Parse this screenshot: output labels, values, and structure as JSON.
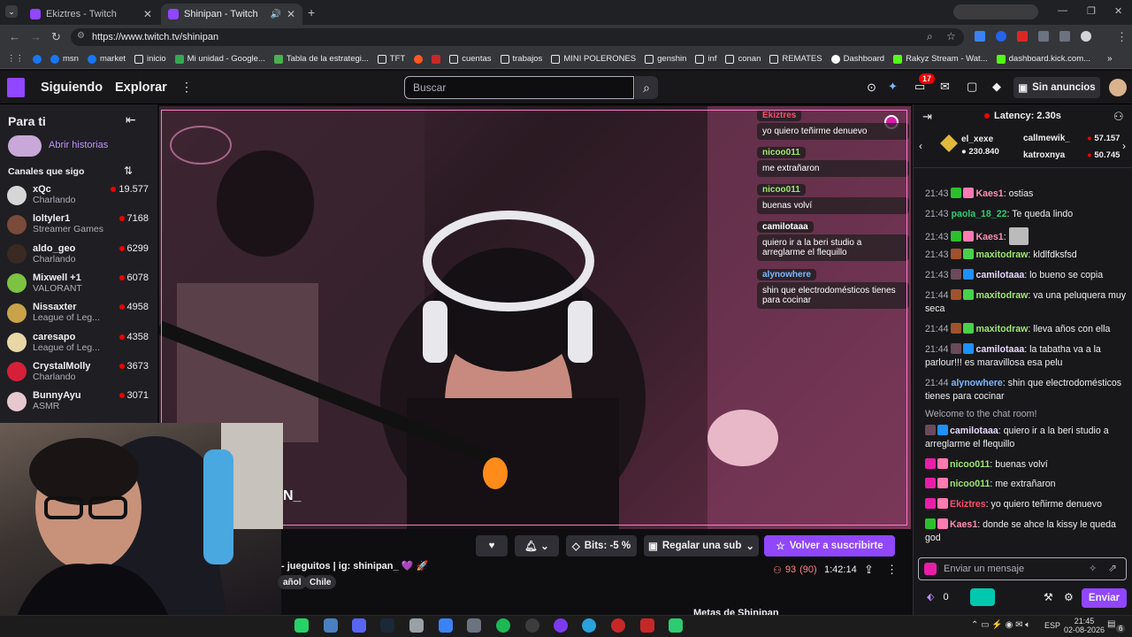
{
  "browser": {
    "tabs": [
      {
        "title": "Ekiztres - Twitch"
      },
      {
        "title": "Shinipan - Twitch"
      }
    ],
    "url": "https://www.twitch.tv/shinipan",
    "bookmarks": [
      "msn",
      "market",
      "inicio",
      "Mi unidad - Google...",
      "Tabla de la estrategi...",
      "TFT",
      "cuentas",
      "trabajos",
      "MINI POLERONES",
      "genshin",
      "inf",
      "conan",
      "REMATES",
      "Dashboard",
      "Rakyz Stream - Wat...",
      "dashboard.kick.com..."
    ]
  },
  "nav": {
    "following": "Siguiendo",
    "browse": "Explorar",
    "search_placeholder": "Buscar",
    "notif_count": "17",
    "ad_free": "Sin anuncios"
  },
  "sidebar": {
    "title": "Para ti",
    "stories": "Abrir historias",
    "followed_title": "Canales que sigo",
    "channels": [
      {
        "name": "xQc",
        "game": "Charlando",
        "viewers": "19.577",
        "color": "#d6d6d6"
      },
      {
        "name": "loltyler1",
        "game": "Streamer Games",
        "viewers": "7168",
        "color": "#7a4a3a"
      },
      {
        "name": "aldo_geo",
        "game": "Charlando",
        "viewers": "6299",
        "color": "#3a2a22"
      },
      {
        "name": "Mixwell +1",
        "game": "VALORANT",
        "viewers": "6078",
        "color": "#7dc242"
      },
      {
        "name": "Nissaxter",
        "game": "League of Leg...",
        "viewers": "4958",
        "color": "#c9a24a"
      },
      {
        "name": "caresapo",
        "game": "League of Leg...",
        "viewers": "4358",
        "color": "#e8d8a8"
      },
      {
        "name": "CrystalMolly",
        "game": "Charlando",
        "viewers": "3673",
        "color": "#d6203a"
      },
      {
        "name": "BunnyAyu",
        "game": "ASMR",
        "viewers": "3071",
        "color": "#e8c8d0"
      }
    ]
  },
  "overlay": {
    "bubbles": [
      {
        "user": "Ekiztres",
        "text": "yo quiero teñirme denuevo",
        "color": "#ff4d6d"
      },
      {
        "user": "nicoo011",
        "text": "me extrañaron",
        "color": "#9fe870"
      },
      {
        "user": "nicoo011",
        "text": "buenas volví",
        "color": "#9fe870"
      },
      {
        "user": "camilotaaa",
        "text": "quiero ir a la beri studio a arreglarme el flequillo",
        "color": "#ffffff"
      },
      {
        "user": "alynowhere",
        "text": "shin que electrodomésticos tienes para cocinar",
        "color": "#7ab8ff"
      }
    ],
    "cam_text": "N_"
  },
  "player": {
    "bits": "Bits: -5 %",
    "gift": "Regalar una sub",
    "resub": "Volver a suscribirte",
    "title": "- jueguitos | ig: shinipan_ 💜 🚀",
    "tags": [
      "añol",
      "Chile"
    ],
    "viewers": "93",
    "viewers_paren": "(90)",
    "uptime": "1:42:14",
    "more": "Metas de Shinipan"
  },
  "chat": {
    "latency": "Latency: 2.30s",
    "leaders": [
      {
        "name": "el_xexe",
        "points": "230.840"
      },
      {
        "name": "callmewik_",
        "points": "57.157"
      },
      {
        "name": "katroxnya",
        "points": "50.745"
      }
    ],
    "messages": [
      {
        "time": "21:43",
        "user": "Kaes1",
        "ucolor": "#ff8fb0",
        "text": "ostias",
        "b": [
          "#2cbf2c",
          "#ff7ab0"
        ]
      },
      {
        "time": "21:43",
        "user": "paola_18_22",
        "ucolor": "#2ecc71",
        "text": "Te queda lindo",
        "b": []
      },
      {
        "time": "21:43",
        "user": "Kaes1",
        "ucolor": "#ff8fb0",
        "text": "",
        "b": [
          "#2cbf2c",
          "#ff7ab0"
        ]
      },
      {
        "time": "21:43",
        "user": "maxitodraw",
        "ucolor": "#9fe870",
        "text": "kldlfdksfsd",
        "b": [
          "#a0522d",
          "#47d14a"
        ]
      },
      {
        "time": "21:43",
        "user": "camilotaaa",
        "ucolor": "#e8d8ff",
        "text": "lo bueno se copia",
        "b": [
          "#6b4a5a",
          "#1e90ff"
        ]
      },
      {
        "time": "21:44",
        "user": "maxitodraw",
        "ucolor": "#9fe870",
        "text": "va una peluquera muy seca",
        "b": [
          "#a0522d",
          "#47d14a"
        ]
      },
      {
        "time": "21:44",
        "user": "maxitodraw",
        "ucolor": "#9fe870",
        "text": "lleva años con ella",
        "b": [
          "#a0522d",
          "#47d14a"
        ]
      },
      {
        "time": "21:44",
        "user": "camilotaaa",
        "ucolor": "#e8d8ff",
        "text": "la tabatha va a la parlour!!! es maravillosa esa pelu",
        "b": [
          "#6b4a5a",
          "#1e90ff"
        ]
      },
      {
        "time": "21:44",
        "user": "alynowhere",
        "ucolor": "#7ab8ff",
        "text": "shin que electrodomésticos tienes para cocinar",
        "b": []
      }
    ],
    "welcome": "Welcome to the chat room!",
    "messages2": [
      {
        "user": "camilotaaa",
        "ucolor": "#e8d8ff",
        "text": "quiero ir a la beri studio a arreglarme el flequillo",
        "b": [
          "#6b4a5a",
          "#1e90ff"
        ]
      },
      {
        "user": "nicoo011",
        "ucolor": "#9fe870",
        "text": "buenas volví",
        "b": [
          "#e81ea8",
          "#ff7ab0"
        ]
      },
      {
        "user": "nicoo011",
        "ucolor": "#9fe870",
        "text": "me extrañaron",
        "b": [
          "#e81ea8",
          "#ff7ab0"
        ]
      },
      {
        "user": "Ekiztres",
        "ucolor": "#ff4d6d",
        "text": "yo quiero teñirme denuevo",
        "b": [
          "#e81ea8",
          "#ff7ab0"
        ]
      },
      {
        "user": "Kaes1",
        "ucolor": "#ff8fb0",
        "text": "donde se ahce la kissy le queda god",
        "b": [
          "#2cbf2c",
          "#ff7ab0"
        ]
      }
    ],
    "input_placeholder": "Enviar un mensaje",
    "points": "0",
    "send": "Enviar"
  },
  "taskbar": {
    "lang": "ESP",
    "time": "21:45",
    "date": "02-08-2026",
    "notif": "6"
  }
}
